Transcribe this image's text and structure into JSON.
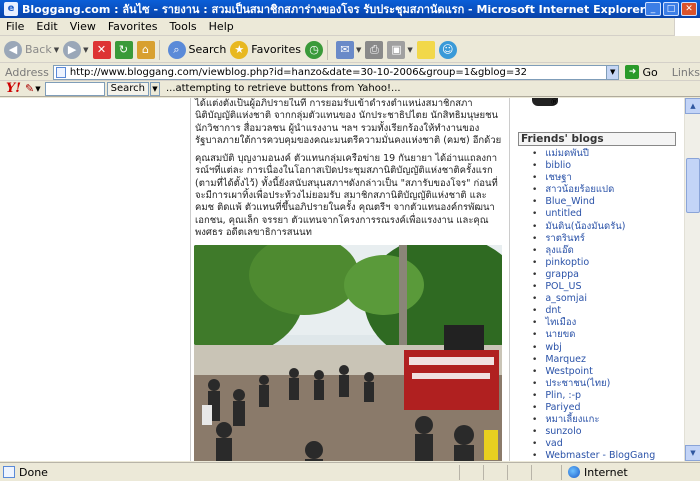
{
  "window": {
    "title": "Bloggang.com : ลันไซ - รายงาน : สวมเป็นสมาชิกสภาร่างของโจร รับประชุมสภานัดแรก - Microsoft Internet Explorer",
    "icon_text": "e"
  },
  "menu": [
    "File",
    "Edit",
    "View",
    "Favorites",
    "Tools",
    "Help"
  ],
  "toolbar": {
    "back_label": "Back",
    "search_label": "Search",
    "favorites_label": "Favorites"
  },
  "address": {
    "label": "Address",
    "url": "http://www.bloggang.com/viewblog.php?id=hanzo&date=30-10-2006&group=1&gblog=32",
    "go_label": "Go",
    "links_label": "Links"
  },
  "yahoo": {
    "logo": "Y!",
    "search_label": "Search",
    "message": "...attempting to retrieve buttons from Yahoo!..."
  },
  "article": {
    "paragraphs": [
      "ได้แต่งตั้งเป็นผู้อภิปรายในที่ การยอมรับเข้าดำรงตำแหน่งสมาชิกสภานิติบัญญัติแห่งชาติ จากกลุ่มตัวแทนของ นักประชาธิปไตย นักสิทธิมนุษยชน นักวิชาการ สื่อมวลชน ผู้นำแรงงาน ฯลฯ รวมทั้งเรียกร้องให้ทำงานของรัฐบาลภายใต้การควบคุมของคณะมนตรีความมั่นคงแห่งชาติ (คมช) อีกด้วย",
      "คุณสมบัติ บุญงามอนงค์ ตัวแทนกลุ่มเครือข่าย 19 กันยายา ได้อ่านแถลงการณ์ฯที่แต่ละ การเนื่องในโอกาสเปิดประชุมสภานิติบัญญัติแห่งชาติครั้งแรก (ตามที่ได้ตั้งไว้) ทั้งนี้ยังสนับสนุนสภาฯดังกล่าวเป็น \"สภารับของโจร\" ก่อนที่จะมีการเผาทิ้งเพื่อประท้วงไม่ยอมรับ สมาชิกสภานิติบัญญัติแห่งชาติ และคมช ติดแพ้ ตัวแทนที่ขึ้นอภิปรายในครั้ง คุณตรีฯ จากตัวแทนองค์กรพัฒนาเอกชน, คุณเล็ก จรรยา ตัวแทนจากโครงการรณรงค์เพื่อแรงงาน และคุณพงศธร อดีตเลขาธิการสนนท"
    ]
  },
  "sidebar": {
    "title": "Friends' blogs",
    "friends": [
      "แม่มดพันปี",
      "biblio",
      "เชษฐา",
      "สาวน้อยร้อยแปด",
      "Blue_Wind",
      "untitled",
      "มันดิน(น้องมันดรัน)",
      "ราตรินทร์",
      "ลุงแอ๊ด",
      "pinkoptio",
      "grappa",
      "POL_US",
      "a_somjai",
      "dnt",
      "ไทเมือง",
      "นายขด",
      "wbj",
      "Marquez",
      "Westpoint",
      "ประชาชน(ไทย)",
      "Plin, :-p",
      "Pariyed",
      "หมาเลี้ยงแกะ",
      "sunzolo",
      "vad",
      "Webmaster - BlogGang"
    ]
  },
  "status": {
    "text": "Done",
    "zone": "Internet"
  }
}
